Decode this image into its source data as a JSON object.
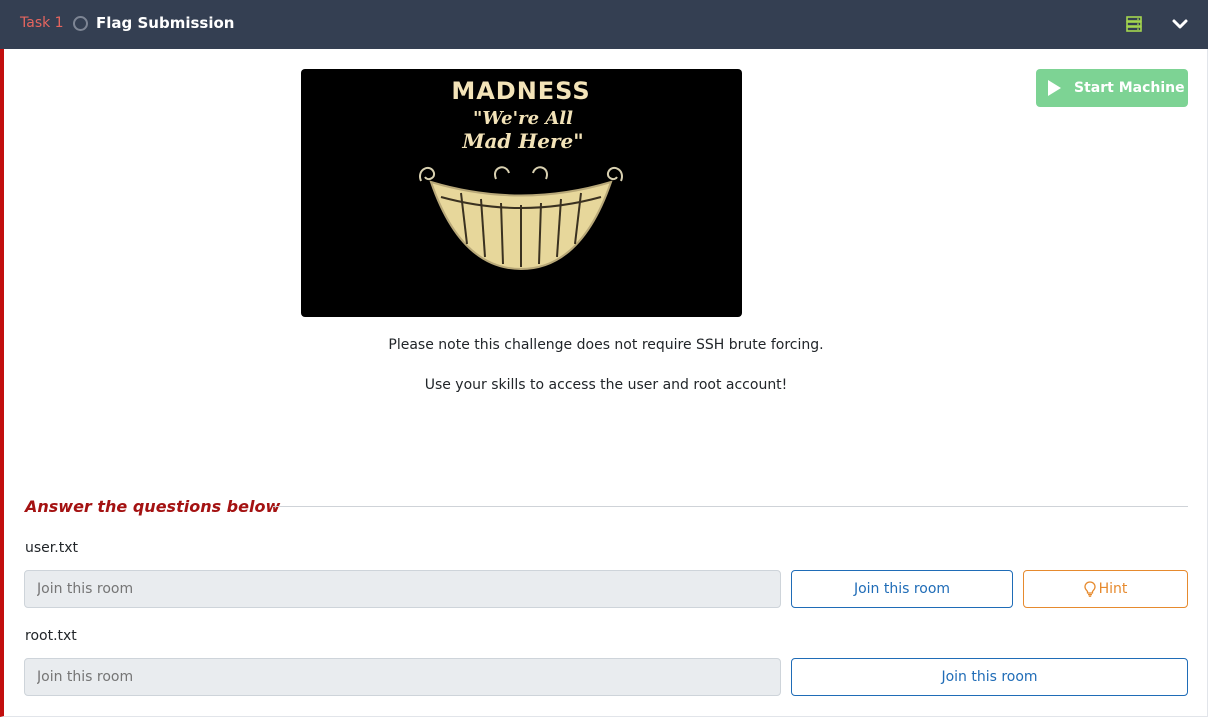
{
  "task": {
    "number_label": "Task 1",
    "title": "Flag Submission"
  },
  "banner": {
    "title": "MADNESS",
    "tagline_line1": "\"We're All",
    "tagline_line2": "Mad Here\""
  },
  "machine": {
    "start_label": "Start Machine"
  },
  "description": [
    "Please note this challenge does not require SSH brute forcing.",
    "Use your skills to access the user and root account!"
  ],
  "answers": {
    "heading": "Answer the questions below",
    "questions": [
      {
        "label": "user.txt",
        "placeholder": "Join this room",
        "button": "Join this room",
        "hint": "Hint"
      },
      {
        "label": "root.txt",
        "placeholder": "Join this room",
        "button": "Join this room"
      }
    ]
  },
  "colors": {
    "header_bg": "#343f52",
    "task_accent": "#c20e0e",
    "start_button": "#7dd394",
    "join_button": "#1f6cb7",
    "hint_button": "#e68a2e"
  },
  "icons": [
    "status-circle-icon",
    "server-icon",
    "chevron-down-icon",
    "play-icon",
    "lightbulb-icon"
  ]
}
